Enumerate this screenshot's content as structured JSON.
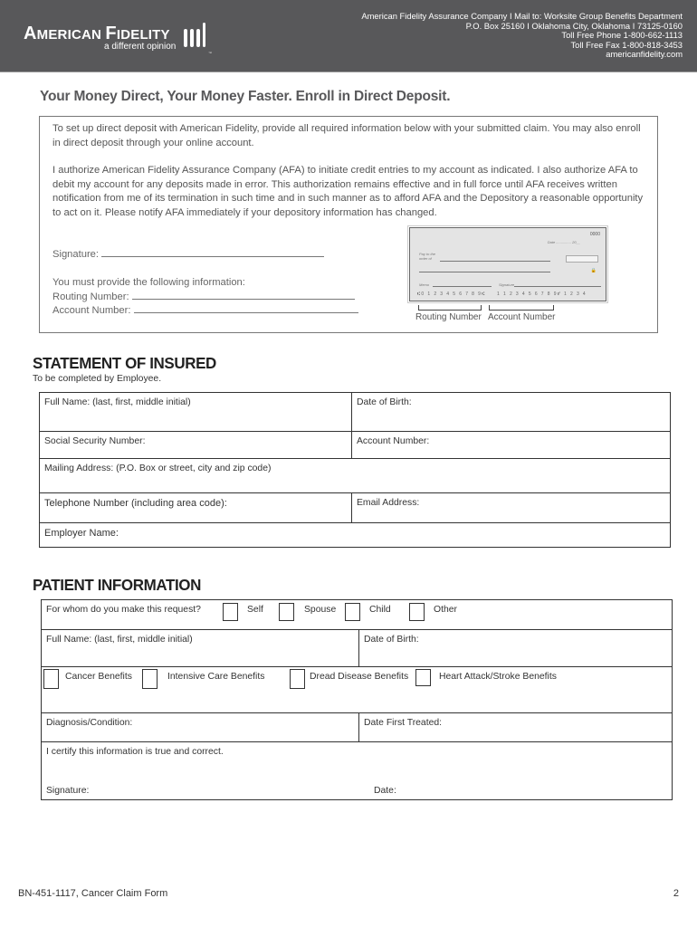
{
  "header": {
    "logo_name_first": "A",
    "logo_name_rest1": "MERICAN ",
    "logo_name_f": "F",
    "logo_name_rest2": "IDELITY",
    "tagline": "a different opinion",
    "trademark": "™",
    "contact_lines": [
      "American Fidelity Assurance Company  I  Mail to: Worksite Group Benefits Department",
      "P.O. Box 25160  I  Oklahoma City, Oklahoma  I  73125-0160",
      "Toll Free Phone 1-800-662-1113",
      "Toll Free Fax  1-800-818-3453",
      "americanfidelity.com"
    ],
    "bg_color": "#58585a"
  },
  "direct_deposit": {
    "title": "Your Money Direct, Your Money Faster. Enroll in Direct Deposit.",
    "paragraph1": "To set up direct deposit with American Fidelity, provide all required information below with your submitted claim. You may also enroll in direct deposit through your online account.",
    "paragraph2": "I authorize American Fidelity Assurance Company (AFA) to initiate credit entries to my account as indicated. I also authorize AFA to debit my account for any deposits made in error. This authorization remains effective and in full force until AFA receives written notification from me of its termination in such time and in such manner as to afford AFA and the Depository a reasonable opportunity to act on it.  Please notify AFA immediately if your depository information has changed.",
    "signature_label": "Signature:",
    "must_provide": "You must provide the following information:",
    "routing_label": "Routing Number:",
    "account_label": "Account Number:",
    "check": {
      "number": "0000",
      "date_label": "Date ............... 20__",
      "pay_to_label": "Pay to the",
      "order_of_label": "order of",
      "lock_symbol": "🔒",
      "memo_label": "Memo",
      "signature_label": "Signature",
      "micr_routing": "⑆0 1 2 3 4 5 6 7 8 9⑆",
      "micr_account": "1 1 2 3 4 5 6 7 8 9⑈",
      "micr_check": "1 2 3 4"
    },
    "caption_routing": "Routing Number",
    "caption_account": "Account Number"
  },
  "statement_of_insured": {
    "title": "STATEMENT OF INSURED",
    "subtitle": "To be completed by Employee.",
    "fields": {
      "full_name": "Full Name: (last, first, middle initial)",
      "date_of_birth": "Date of Birth:",
      "ssn": "Social Security Number:",
      "account_number": "Account Number:",
      "mailing_address": "Mailing Address: (P.O. Box or street, city and zip code)",
      "telephone": "Telephone Number (including area code):",
      "email": "Email Address:",
      "employer": "Employer Name:"
    }
  },
  "patient_information": {
    "title": "PATIENT INFORMATION",
    "request_question": "For whom do you make this request?",
    "request_options": [
      "Self",
      "Spouse",
      "Child",
      "Other"
    ],
    "full_name": "Full Name: (last, first, middle initial)",
    "date_of_birth": "Date of Birth:",
    "benefit_options": [
      "Cancer Benefits",
      "Intensive Care Benefits",
      "Dread Disease Benefits",
      "Heart Attack/Stroke Benefits"
    ],
    "diagnosis": "Diagnosis/Condition:",
    "date_first_treated": "Date First Treated:",
    "certify": "I certify this information is true and correct.",
    "signature": "Signature:",
    "date": "Date:"
  },
  "footer": {
    "form_id": "BN-451-1117, Cancer Claim Form",
    "page_number": "2"
  }
}
